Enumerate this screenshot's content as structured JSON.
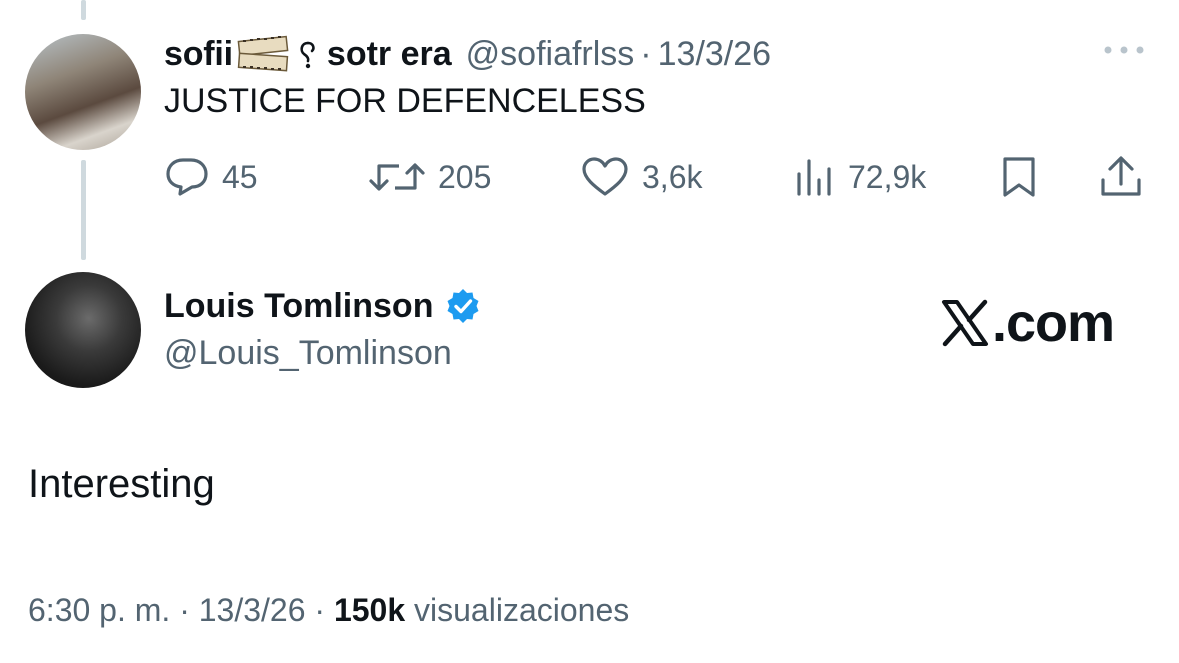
{
  "quoted_tweet": {
    "display_name": "sofii",
    "display_name_suffix": "sotr era",
    "emoji_1": "film-frames-icon",
    "emoji_2": "ear-icon",
    "handle": "@sofiafrlss",
    "separator": "·",
    "date": "13/3/26",
    "text": "JUSTICE FOR DEFENCELESS",
    "actions": {
      "replies": "45",
      "retweets": "205",
      "likes": "3,6k",
      "views": "72,9k"
    }
  },
  "main_tweet": {
    "display_name": "Louis Tomlinson",
    "verified": true,
    "handle": "@Louis_Tomlinson",
    "watermark": ".com",
    "text": "Interesting",
    "time": "6:30 p. m.",
    "separator": "·",
    "date": "13/3/26",
    "views_count": "150k",
    "views_label": "visualizaciones"
  },
  "colors": {
    "text": "#0f1419",
    "secondary": "#536471",
    "verified": "#1d9bf0",
    "thread_line": "#cfd9de"
  }
}
